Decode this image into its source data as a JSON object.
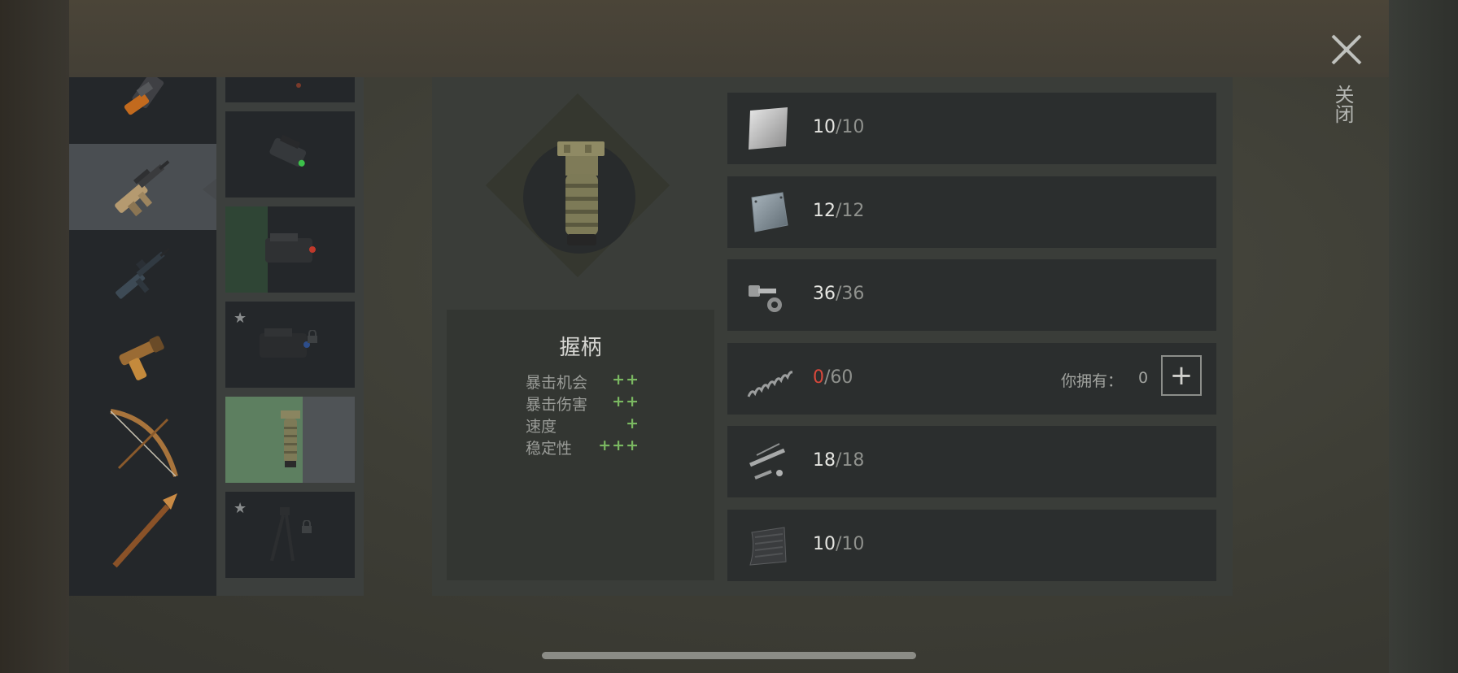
{
  "close": {
    "label": "关闭",
    "icon": "close-icon"
  },
  "weapons": [
    {
      "name": "pistol-icon",
      "selected": false
    },
    {
      "name": "assault-rifle-icon",
      "selected": true
    },
    {
      "name": "m16-rifle-icon",
      "selected": false
    },
    {
      "name": "flare-gun-icon",
      "selected": false
    },
    {
      "name": "bow-icon",
      "selected": false
    },
    {
      "name": "spear-icon",
      "selected": false
    }
  ],
  "attachments": [
    {
      "name": "partial-attachment-icon",
      "starred": false,
      "locked": false
    },
    {
      "name": "flashlight-attachment-icon",
      "starred": false,
      "locked": false
    },
    {
      "name": "laser-sight-icon",
      "starred": false,
      "locked": false
    },
    {
      "name": "laser-sight-blue-icon",
      "starred": true,
      "locked": true
    },
    {
      "name": "vertical-grip-icon",
      "starred": false,
      "locked": false,
      "selected": true
    },
    {
      "name": "bipod-icon",
      "starred": true,
      "locked": true
    }
  ],
  "item": {
    "title": "握柄",
    "stats": [
      {
        "name": "暴击机会",
        "value": "++"
      },
      {
        "name": "暴击伤害",
        "value": "++"
      },
      {
        "name": "速度",
        "value": "+"
      },
      {
        "name": "稳定性",
        "value": "+++"
      }
    ]
  },
  "materials": [
    {
      "icon": "metal-sheet-icon",
      "current": "10",
      "max": "/10"
    },
    {
      "icon": "steel-plate-icon",
      "current": "12",
      "max": "/12"
    },
    {
      "icon": "bolt-nut-icon",
      "current": "36",
      "max": "/36"
    },
    {
      "icon": "spring-icon",
      "current": "0",
      "max": "/60",
      "insufficient": true,
      "own_label": "你拥有：",
      "own_value": "0",
      "add_label": "+"
    },
    {
      "icon": "gun-parts-icon",
      "current": "18",
      "max": "/18"
    },
    {
      "icon": "rubber-mat-icon",
      "current": "10",
      "max": "/10"
    }
  ],
  "colors": {
    "accent_green": "#7ab861",
    "warning_red": "#d9483b",
    "selected_green": "#5d7f60"
  }
}
